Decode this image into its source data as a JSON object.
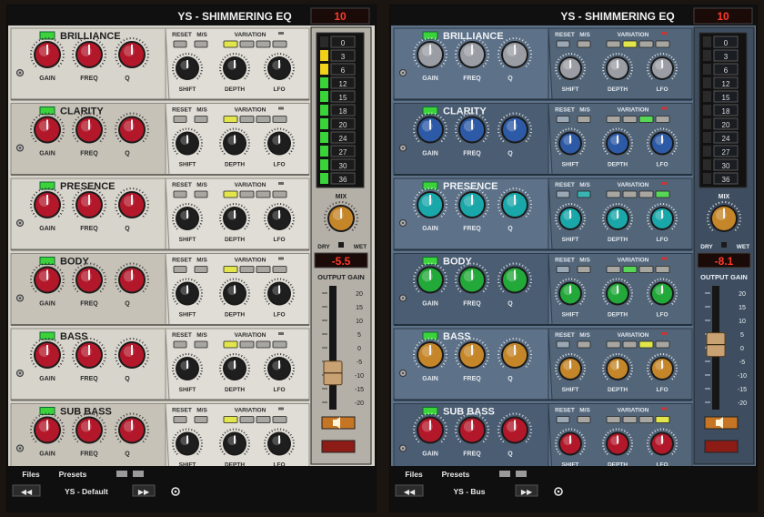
{
  "plugins": [
    {
      "id": "p1",
      "theme": "silver",
      "title": "YS - SHIMMERING EQ",
      "header_display": "10",
      "meter_scale": [
        "0",
        "3",
        "6",
        "12",
        "15",
        "18",
        "20",
        "24",
        "27",
        "30",
        "36"
      ],
      "mix_label": "MIX",
      "dry_label": "DRY",
      "wet_label": "WET",
      "output_display": "-5.5",
      "output_label": "OUTPUT GAIN",
      "fader_scale": [
        "20",
        "15",
        "10",
        "5",
        "0",
        "-5",
        "-10",
        "-15",
        "-20"
      ],
      "files_label": "Files",
      "presets_label": "Presets",
      "preset_name": "YS - Default",
      "prev_label": "◀◀",
      "next_label": "▶▶",
      "bands": [
        {
          "name": "BRILLIANCE"
        },
        {
          "name": "CLARITY"
        },
        {
          "name": "PRESENCE"
        },
        {
          "name": "BODY"
        },
        {
          "name": "BASS"
        },
        {
          "name": "SUB BASS"
        }
      ],
      "labels": {
        "gain": "GAIN",
        "freq": "FREQ",
        "q": "Q",
        "reset": "RESET",
        "ms": "M/S",
        "variation": "VARIATION",
        "shift": "SHIFT",
        "depth": "DEPTH",
        "lfo": "LFO"
      }
    },
    {
      "id": "p2",
      "theme": "blue",
      "title": "YS - SHIMMERING EQ",
      "header_display": "10",
      "meter_scale": [
        "0",
        "3",
        "6",
        "12",
        "15",
        "18",
        "20",
        "24",
        "27",
        "30",
        "36"
      ],
      "mix_label": "MIX",
      "dry_label": "DRY",
      "wet_label": "WET",
      "output_display": "-8.1",
      "output_label": "OUTPUT GAIN",
      "fader_scale": [
        "20",
        "15",
        "10",
        "5",
        "0",
        "-5",
        "-10",
        "-15",
        "-20"
      ],
      "files_label": "Files",
      "presets_label": "Presets",
      "preset_name": "YS - Bus",
      "prev_label": "◀◀",
      "next_label": "▶▶",
      "bands": [
        {
          "name": "BRILLIANCE"
        },
        {
          "name": "CLARITY"
        },
        {
          "name": "PRESENCE"
        },
        {
          "name": "BODY"
        },
        {
          "name": "BASS"
        },
        {
          "name": "SUB BASS"
        }
      ],
      "labels": {
        "gain": "GAIN",
        "freq": "FREQ",
        "q": "Q",
        "reset": "RESET",
        "ms": "M/S",
        "variation": "VARIATION",
        "shift": "SHIFT",
        "depth": "DEPTH",
        "lfo": "LFO"
      }
    }
  ],
  "colors": {
    "silver_panel": "#d7d4cc",
    "blue_panel": "#5d7188",
    "red_knob": "#b3182a",
    "gray_knob": "#9a9ea4",
    "blue_knob": "#2d5aa6",
    "teal_knob": "#1aa7a9",
    "green_knob": "#23a83a",
    "orange_knob": "#c5862a",
    "display_red": "#ff3a2a",
    "led_green": "#3ad43a",
    "meter_yellow": "#f0d21a"
  },
  "blue_band_knob_colors": [
    "gray",
    "blue",
    "teal",
    "green",
    "orange",
    "red"
  ],
  "meter_lit_segments": {
    "p1": 10,
    "p2": 0
  },
  "mix_level": {
    "p1": 0.5,
    "p2": 0.5
  },
  "fader_level": {
    "p1": 0.36,
    "p2": 0.62
  }
}
